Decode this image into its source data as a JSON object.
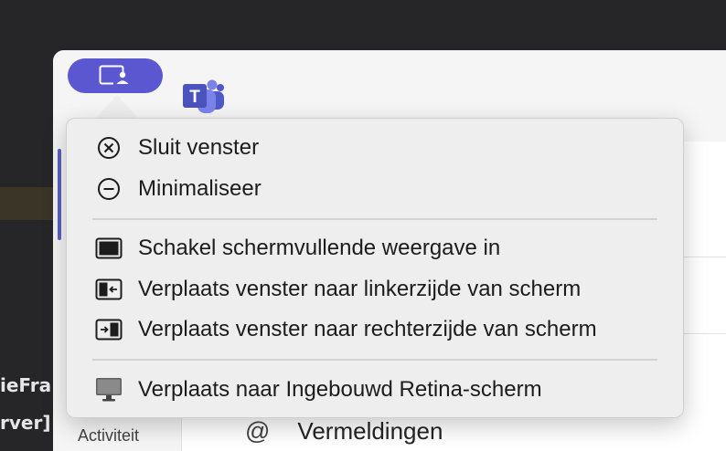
{
  "background": {
    "code_line_1": "ieFra",
    "code_line_2": "rver]"
  },
  "titlebar": {
    "window_button_icon": "screen-person-icon",
    "app_logo": "teams-logo-icon",
    "accent": "#5b57d1"
  },
  "sidebar": {
    "activity_label": "Activiteit"
  },
  "main": {
    "mentions_label": "Vermeldingen",
    "mentions_icon": "@"
  },
  "menu": {
    "groups": [
      [
        {
          "label": "Sluit venster",
          "icon": "close-circle-icon"
        },
        {
          "label": "Minimaliseer",
          "icon": "minus-circle-icon"
        }
      ],
      [
        {
          "label": "Schakel schermvullende weergave in",
          "icon": "fullscreen-icon"
        },
        {
          "label": "Verplaats venster naar linkerzijde van scherm",
          "icon": "tile-left-icon"
        },
        {
          "label": "Verplaats venster naar rechterzijde van scherm",
          "icon": "tile-right-icon"
        }
      ],
      [
        {
          "label": "Verplaats naar Ingebouwd Retina-scherm",
          "icon": "display-icon"
        }
      ]
    ]
  }
}
